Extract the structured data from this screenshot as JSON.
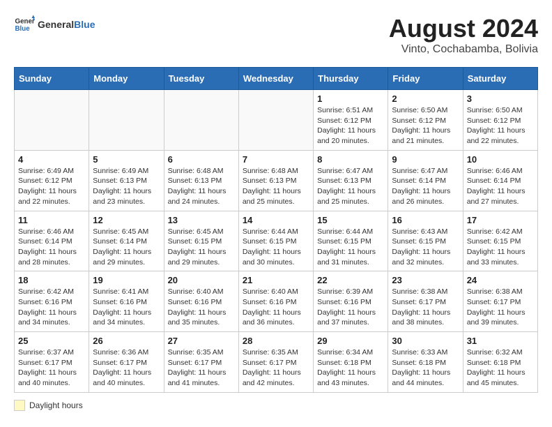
{
  "header": {
    "logo_general": "General",
    "logo_blue": "Blue",
    "month_year": "August 2024",
    "location": "Vinto, Cochabamba, Bolivia"
  },
  "days_of_week": [
    "Sunday",
    "Monday",
    "Tuesday",
    "Wednesday",
    "Thursday",
    "Friday",
    "Saturday"
  ],
  "weeks": [
    [
      {
        "day": "",
        "info": ""
      },
      {
        "day": "",
        "info": ""
      },
      {
        "day": "",
        "info": ""
      },
      {
        "day": "",
        "info": ""
      },
      {
        "day": "1",
        "info": "Sunrise: 6:51 AM\nSunset: 6:12 PM\nDaylight: 11 hours and 20 minutes."
      },
      {
        "day": "2",
        "info": "Sunrise: 6:50 AM\nSunset: 6:12 PM\nDaylight: 11 hours and 21 minutes."
      },
      {
        "day": "3",
        "info": "Sunrise: 6:50 AM\nSunset: 6:12 PM\nDaylight: 11 hours and 22 minutes."
      }
    ],
    [
      {
        "day": "4",
        "info": "Sunrise: 6:49 AM\nSunset: 6:12 PM\nDaylight: 11 hours and 22 minutes."
      },
      {
        "day": "5",
        "info": "Sunrise: 6:49 AM\nSunset: 6:13 PM\nDaylight: 11 hours and 23 minutes."
      },
      {
        "day": "6",
        "info": "Sunrise: 6:48 AM\nSunset: 6:13 PM\nDaylight: 11 hours and 24 minutes."
      },
      {
        "day": "7",
        "info": "Sunrise: 6:48 AM\nSunset: 6:13 PM\nDaylight: 11 hours and 25 minutes."
      },
      {
        "day": "8",
        "info": "Sunrise: 6:47 AM\nSunset: 6:13 PM\nDaylight: 11 hours and 25 minutes."
      },
      {
        "day": "9",
        "info": "Sunrise: 6:47 AM\nSunset: 6:14 PM\nDaylight: 11 hours and 26 minutes."
      },
      {
        "day": "10",
        "info": "Sunrise: 6:46 AM\nSunset: 6:14 PM\nDaylight: 11 hours and 27 minutes."
      }
    ],
    [
      {
        "day": "11",
        "info": "Sunrise: 6:46 AM\nSunset: 6:14 PM\nDaylight: 11 hours and 28 minutes."
      },
      {
        "day": "12",
        "info": "Sunrise: 6:45 AM\nSunset: 6:14 PM\nDaylight: 11 hours and 29 minutes."
      },
      {
        "day": "13",
        "info": "Sunrise: 6:45 AM\nSunset: 6:15 PM\nDaylight: 11 hours and 29 minutes."
      },
      {
        "day": "14",
        "info": "Sunrise: 6:44 AM\nSunset: 6:15 PM\nDaylight: 11 hours and 30 minutes."
      },
      {
        "day": "15",
        "info": "Sunrise: 6:44 AM\nSunset: 6:15 PM\nDaylight: 11 hours and 31 minutes."
      },
      {
        "day": "16",
        "info": "Sunrise: 6:43 AM\nSunset: 6:15 PM\nDaylight: 11 hours and 32 minutes."
      },
      {
        "day": "17",
        "info": "Sunrise: 6:42 AM\nSunset: 6:15 PM\nDaylight: 11 hours and 33 minutes."
      }
    ],
    [
      {
        "day": "18",
        "info": "Sunrise: 6:42 AM\nSunset: 6:16 PM\nDaylight: 11 hours and 34 minutes."
      },
      {
        "day": "19",
        "info": "Sunrise: 6:41 AM\nSunset: 6:16 PM\nDaylight: 11 hours and 34 minutes."
      },
      {
        "day": "20",
        "info": "Sunrise: 6:40 AM\nSunset: 6:16 PM\nDaylight: 11 hours and 35 minutes."
      },
      {
        "day": "21",
        "info": "Sunrise: 6:40 AM\nSunset: 6:16 PM\nDaylight: 11 hours and 36 minutes."
      },
      {
        "day": "22",
        "info": "Sunrise: 6:39 AM\nSunset: 6:16 PM\nDaylight: 11 hours and 37 minutes."
      },
      {
        "day": "23",
        "info": "Sunrise: 6:38 AM\nSunset: 6:17 PM\nDaylight: 11 hours and 38 minutes."
      },
      {
        "day": "24",
        "info": "Sunrise: 6:38 AM\nSunset: 6:17 PM\nDaylight: 11 hours and 39 minutes."
      }
    ],
    [
      {
        "day": "25",
        "info": "Sunrise: 6:37 AM\nSunset: 6:17 PM\nDaylight: 11 hours and 40 minutes."
      },
      {
        "day": "26",
        "info": "Sunrise: 6:36 AM\nSunset: 6:17 PM\nDaylight: 11 hours and 40 minutes."
      },
      {
        "day": "27",
        "info": "Sunrise: 6:35 AM\nSunset: 6:17 PM\nDaylight: 11 hours and 41 minutes."
      },
      {
        "day": "28",
        "info": "Sunrise: 6:35 AM\nSunset: 6:17 PM\nDaylight: 11 hours and 42 minutes."
      },
      {
        "day": "29",
        "info": "Sunrise: 6:34 AM\nSunset: 6:18 PM\nDaylight: 11 hours and 43 minutes."
      },
      {
        "day": "30",
        "info": "Sunrise: 6:33 AM\nSunset: 6:18 PM\nDaylight: 11 hours and 44 minutes."
      },
      {
        "day": "31",
        "info": "Sunrise: 6:32 AM\nSunset: 6:18 PM\nDaylight: 11 hours and 45 minutes."
      }
    ]
  ],
  "legend": {
    "box_label": "Daylight hours"
  }
}
